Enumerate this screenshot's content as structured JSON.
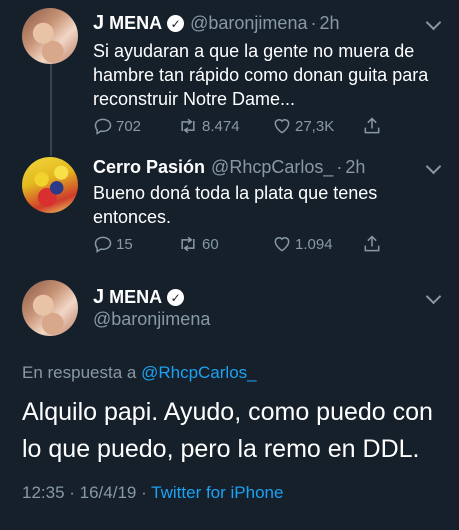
{
  "tweets": [
    {
      "display_name_j": "J",
      "display_name_rest": " MENA",
      "handle": "@baronjimena",
      "time": "2h",
      "text": "Si ayudaran a que la gente no muera de hambre tan rápido como donan guita para reconstruir Notre Dame...",
      "replies": "702",
      "retweets": "8.474",
      "likes": "27,3K",
      "avatar": "avatar-mena"
    },
    {
      "display_name": "Cerro Pasión",
      "handle": "@RhcpCarlos_",
      "time": "2h",
      "text": "Bueno doná toda la plata que tenes entonces.",
      "replies": "15",
      "retweets": "60",
      "likes": "1.094",
      "avatar": "avatar-cerro"
    }
  ],
  "main_tweet": {
    "display_name_j": "J",
    "display_name_rest": " MENA",
    "handle": "@baronjimena",
    "replying_prefix": "En respuesta a ",
    "replying_to": "@RhcpCarlos_",
    "text": "Alquilo papi. Ayudo, como puedo con lo que puedo, pero la remo en DDL.",
    "timestamp": "12:35 · 16/4/19 · ",
    "source": "Twitter for iPhone"
  },
  "separator": "·",
  "icons": [
    "reply-icon",
    "retweet-icon",
    "like-icon",
    "share-icon",
    "verified-icon",
    "chevron-down-icon"
  ],
  "colors": {
    "background": "#15202b",
    "secondary_text": "#8899a6",
    "link": "#1da1f2"
  }
}
